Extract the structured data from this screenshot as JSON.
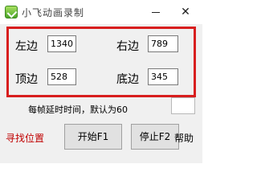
{
  "window": {
    "title": "小飞动画录制",
    "icon": "app-check-icon",
    "close_glyph": "✕"
  },
  "region": {
    "left": {
      "label": "左边",
      "value": "1340"
    },
    "right": {
      "label": "右边",
      "value": "789"
    },
    "top": {
      "label": "顶边",
      "value": "528"
    },
    "bottom": {
      "label": "底边",
      "value": "345"
    },
    "border_color": "#d81e1e"
  },
  "delay": {
    "label": "每帧延时时间，默认为60",
    "value": ""
  },
  "actions": {
    "find_position": "寻找位置",
    "start": "开始F1",
    "stop": "停止F2",
    "help": "帮助",
    "find_position_color": "#c00000"
  }
}
